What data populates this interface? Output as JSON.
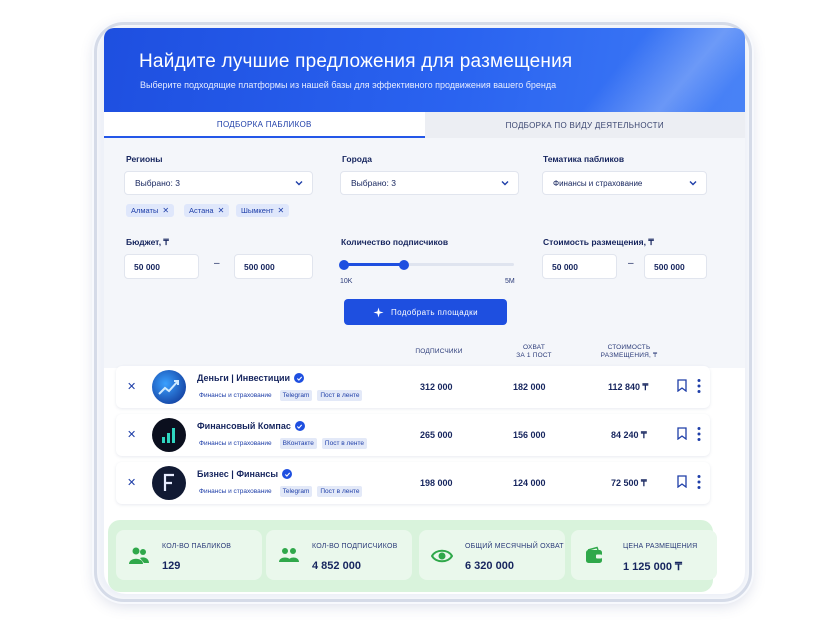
{
  "header": {
    "title": "Найдите лучшие предложения для размещения",
    "subtitle": "Выберите подходящие платформы из нашей базы для эффективного продвижения вашего бренда"
  },
  "tabs": [
    {
      "label": "ПОДБОРКА ПАБЛИКОВ",
      "active": true
    },
    {
      "label": "ПОДБОРКА ПО ВИДУ ДЕЯТЕЛЬНОСТИ",
      "active": false
    }
  ],
  "filters": {
    "regions": {
      "label": "Регионы",
      "value": "Выбрано: 3",
      "chips": [
        "Алматы",
        "Астана",
        "Шымкент"
      ]
    },
    "cities": {
      "label": "Города",
      "value": "Выбрано: 3"
    },
    "topic": {
      "label": "Тематика пабликов",
      "value": "Финансы и страхование"
    },
    "budget": {
      "label": "Бюджет, ₸",
      "from": "50 000",
      "to": "500 000"
    },
    "subscribers": {
      "label": "Количество подписчиков",
      "min_label": "10K",
      "max_label": "5M",
      "range_fraction": [
        0.0,
        0.35
      ]
    },
    "price": {
      "label": "Стоимость размещения, ₸",
      "from": "50 000",
      "to": "500 000"
    },
    "submit_label": "Подобрать площадки"
  },
  "table": {
    "columns": {
      "subscribers": "ПОДПИСЧИКИ",
      "reach_l1": "ОХВАТ",
      "reach_l2": "ЗА 1 ПОСТ",
      "price_l1": "СТОИМОСТЬ",
      "price_l2": "РАЗМЕЩЕНИЯ, ₸"
    },
    "rows": [
      {
        "name": "Деньги | Инвестиции",
        "category": "Финансы и страхование",
        "platform": "Telegram",
        "format": "Пост в ленте",
        "subscribers": "312 000",
        "reach": "182 000",
        "price": "112 840 ₸"
      },
      {
        "name": "Финансовый Компас",
        "category": "Финансы и страхование",
        "platform": "ВКонтакте",
        "format": "Пост в ленте",
        "subscribers": "265 000",
        "reach": "156 000",
        "price": "84 240 ₸"
      },
      {
        "name": "Бизнес | Финансы",
        "category": "Финансы и страхование",
        "platform": "Telegram",
        "format": "Пост в ленте",
        "subscribers": "198 000",
        "reach": "124 000",
        "price": "72 500 ₸"
      }
    ]
  },
  "stats": [
    {
      "label": "КОЛ-ВО ПАБЛИКОВ",
      "value": "129",
      "icon": "users-icon"
    },
    {
      "label": "КОЛ-ВО ПОДПИСЧИКОВ",
      "value": "4 852 000",
      "icon": "subscribers-icon"
    },
    {
      "label": "ОБЩИЙ МЕСЯЧНЫЙ ОХВАТ",
      "value": "6 320 000",
      "icon": "eye-icon"
    },
    {
      "label": "ЦЕНА РАЗМЕЩЕНИЯ",
      "value": "1 125 000 ₸",
      "icon": "wallet-icon"
    }
  ],
  "colors": {
    "primary": "#1e4fe0",
    "stats_bg": "#d9f3dc",
    "stats_icon": "#2fa84a",
    "text": "#16255e"
  }
}
